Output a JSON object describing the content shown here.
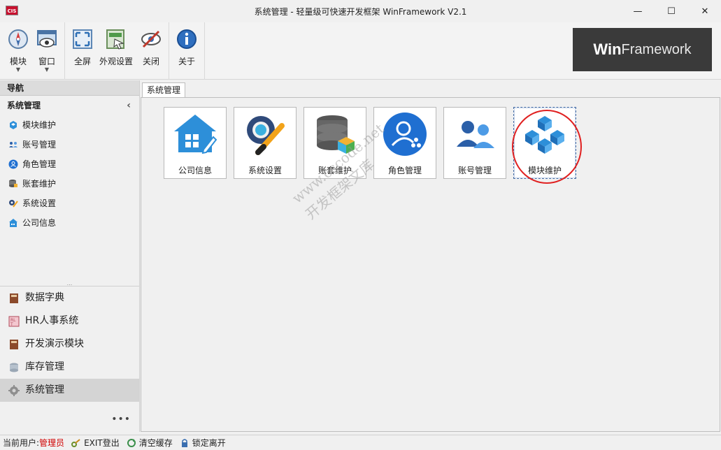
{
  "window": {
    "title": "系统管理 - 轻量级可快速开发框架 WinFramework V2.1",
    "app_icon_text": "CIS",
    "minimize_glyph": "—",
    "maximize_glyph": "☐",
    "close_glyph": "✕"
  },
  "ribbon": {
    "buttons": [
      {
        "label": "模块",
        "icon": "compass-icon"
      },
      {
        "label": "窗口",
        "icon": "window-eye-icon"
      },
      {
        "label": "全屏",
        "icon": "fullscreen-icon"
      },
      {
        "label": "外观设置",
        "icon": "appearance-icon"
      },
      {
        "label": "关闭",
        "icon": "eye-closed-icon"
      },
      {
        "label": "关于",
        "icon": "info-icon"
      }
    ],
    "logo_text_bold": "Win",
    "logo_text": "Framework"
  },
  "sidebar": {
    "header": "导航",
    "group_title": "系统管理",
    "collapse_glyph": "‹",
    "items": [
      {
        "label": "模块维护",
        "icon": "modules-icon"
      },
      {
        "label": "账号管理",
        "icon": "users-icon"
      },
      {
        "label": "角色管理",
        "icon": "role-icon"
      },
      {
        "label": "账套维护",
        "icon": "database-icon"
      },
      {
        "label": "系统设置",
        "icon": "settings-icon"
      },
      {
        "label": "公司信息",
        "icon": "company-icon"
      }
    ],
    "splitter_glyph": "...",
    "bottom_items": [
      {
        "label": "数据字典",
        "icon": "book-icon"
      },
      {
        "label": "HR人事系统",
        "icon": "hr-icon"
      },
      {
        "label": "开发演示模块",
        "icon": "book-icon"
      },
      {
        "label": "库存管理",
        "icon": "stack-icon"
      },
      {
        "label": "系统管理",
        "icon": "gear-icon"
      }
    ],
    "more_glyph": "•••"
  },
  "content": {
    "tab_label": "系统管理",
    "tiles": [
      {
        "label": "公司信息",
        "icon": "company-icon"
      },
      {
        "label": "系统设置",
        "icon": "settings-icon"
      },
      {
        "label": "账套维护",
        "icon": "database-icon"
      },
      {
        "label": "角色管理",
        "icon": "role-icon"
      },
      {
        "label": "账号管理",
        "icon": "users-icon"
      },
      {
        "label": "模块维护",
        "icon": "modules-icon"
      }
    ],
    "watermark_line1": "www.cscode.net",
    "watermark_line2": "开发框架文库"
  },
  "status": {
    "user_label": "当前用户:",
    "user_name": "管理员",
    "logout": "EXIT登出",
    "clear_cache": "清空缓存",
    "lock": "锁定离开"
  },
  "colors": {
    "accent_blue": "#2d8fd9",
    "highlight_red": "#e02020",
    "user_red": "#d00000"
  }
}
